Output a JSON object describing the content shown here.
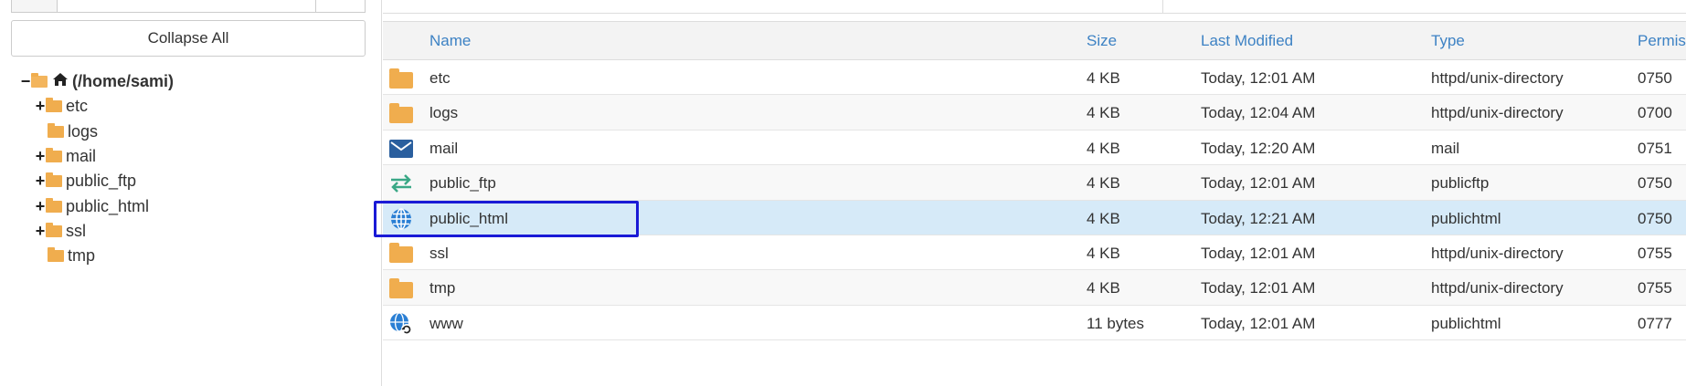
{
  "left_panel": {
    "collapse_label": "Collapse All",
    "tree": {
      "root_label": "(/home/sami)",
      "items": [
        {
          "label": "etc",
          "expandable": true
        },
        {
          "label": "logs",
          "expandable": false
        },
        {
          "label": "mail",
          "expandable": true
        },
        {
          "label": "public_ftp",
          "expandable": true
        },
        {
          "label": "public_html",
          "expandable": true
        },
        {
          "label": "ssl",
          "expandable": true
        },
        {
          "label": "tmp",
          "expandable": false
        }
      ]
    }
  },
  "table": {
    "headers": {
      "name": "Name",
      "size": "Size",
      "modified": "Last Modified",
      "type": "Type",
      "perms": "Permis"
    },
    "rows": [
      {
        "icon": "folder-icon",
        "name": "etc",
        "size": "4 KB",
        "modified": "Today, 12:01 AM",
        "type": "httpd/unix-directory",
        "perms": "0750"
      },
      {
        "icon": "folder-icon",
        "name": "logs",
        "size": "4 KB",
        "modified": "Today, 12:04 AM",
        "type": "httpd/unix-directory",
        "perms": "0700"
      },
      {
        "icon": "mail-icon",
        "name": "mail",
        "size": "4 KB",
        "modified": "Today, 12:20 AM",
        "type": "mail",
        "perms": "0751"
      },
      {
        "icon": "transfer-arrows-icon",
        "name": "public_ftp",
        "size": "4 KB",
        "modified": "Today, 12:01 AM",
        "type": "publicftp",
        "perms": "0750"
      },
      {
        "icon": "globe-icon",
        "name": "public_html",
        "size": "4 KB",
        "modified": "Today, 12:21 AM",
        "type": "publichtml",
        "perms": "0750"
      },
      {
        "icon": "folder-icon",
        "name": "ssl",
        "size": "4 KB",
        "modified": "Today, 12:01 AM",
        "type": "httpd/unix-directory",
        "perms": "0755"
      },
      {
        "icon": "folder-icon",
        "name": "tmp",
        "size": "4 KB",
        "modified": "Today, 12:01 AM",
        "type": "httpd/unix-directory",
        "perms": "0755"
      },
      {
        "icon": "globe-link-icon",
        "name": "www",
        "size": "11 bytes",
        "modified": "Today, 12:01 AM",
        "type": "publichtml",
        "perms": "0777"
      }
    ]
  },
  "colors": {
    "link_blue": "#3d82c4",
    "folder": "#f0ad4e",
    "selected_row": "#d6eaf8",
    "highlight_box": "#1a1ad6",
    "mail_blue": "#2a5f9e",
    "ftp_green": "#3aa886"
  }
}
